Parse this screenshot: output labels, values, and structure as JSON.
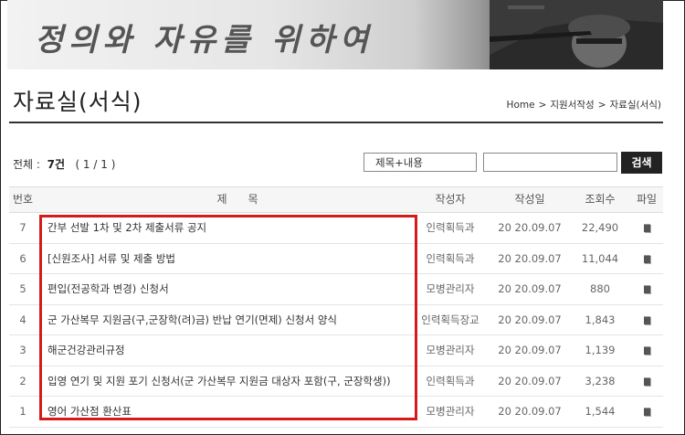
{
  "banner": {
    "title": "정의와 자유를 위하여"
  },
  "page": {
    "title": "자료실(서식)",
    "breadcrumb": [
      "Home",
      "지원서작성",
      "자료실(서식)"
    ],
    "breadcrumb_sep": ">"
  },
  "search": {
    "total_label": "전체 :",
    "total_count": "7건",
    "page_info": "( 1 / 1 )",
    "field_selected": "제목+내용",
    "query": "",
    "button_label": "검색"
  },
  "table": {
    "columns": {
      "no": "번호",
      "title": "제      목",
      "author": "작성자",
      "date": "작성일",
      "views": "조회수",
      "file": "파일"
    },
    "rows": [
      {
        "no": "7",
        "title": "간부 선발 1차 및 2차 제출서류 공지",
        "author": "인력획득과",
        "date": "20 20.09.07",
        "views": "22,490"
      },
      {
        "no": "6",
        "title": "[신원조사] 서류 및 제출 방법",
        "author": "인력획득과",
        "date": "20 20.09.07",
        "views": "11,044"
      },
      {
        "no": "5",
        "title": "편입(전공학과 변경) 신청서",
        "author": "모병관리자",
        "date": "20 20.09.07",
        "views": "880"
      },
      {
        "no": "4",
        "title": "군 가산복무 지원금(구,군장학(려)금) 반납 연기(면제) 신청서 양식",
        "author": "인력획득장교",
        "date": "20 20.09.07",
        "views": "1,843"
      },
      {
        "no": "3",
        "title": "해군건강관리규정",
        "author": "모병관리자",
        "date": "20 20.09.07",
        "views": "1,139"
      },
      {
        "no": "2",
        "title": "입영 연기 및 지원 포기 신청서(군 가산복무 지원금 대상자 포함(구, 군장학생))",
        "author": "인력획득과",
        "date": "20 20.09.07",
        "views": "3,238"
      },
      {
        "no": "1",
        "title": "영어 가산점 환산표",
        "author": "모병관리자",
        "date": "20 20.09.07",
        "views": "1,544"
      }
    ]
  },
  "colors": {
    "highlight": "#d61a1a",
    "button_bg": "#222222"
  },
  "icons": {
    "file": "attachment-icon"
  }
}
